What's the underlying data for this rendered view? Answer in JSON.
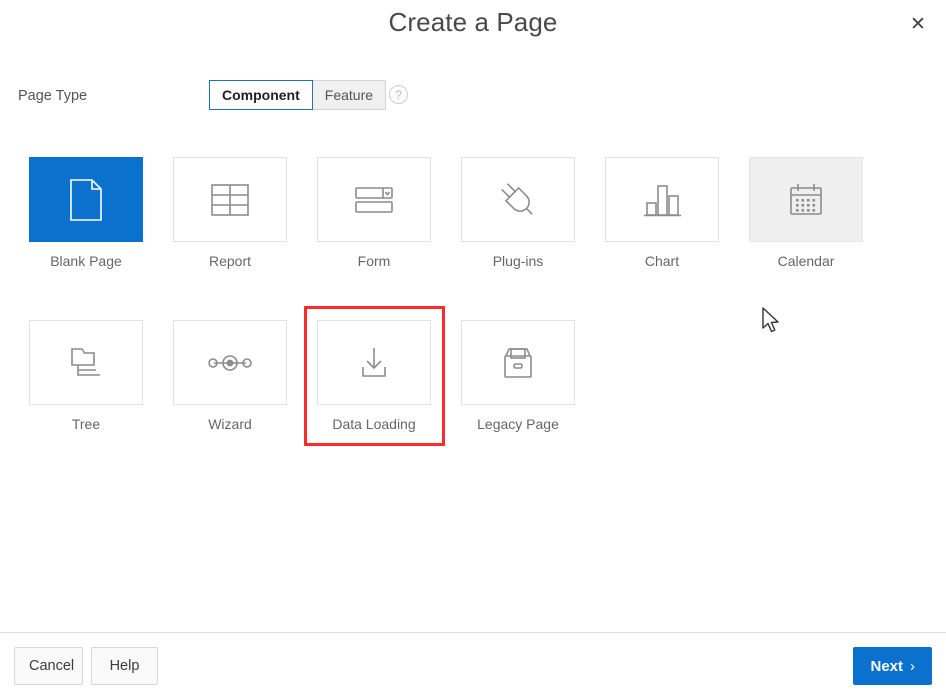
{
  "dialog": {
    "title": "Create a Page",
    "close_icon": "close-icon"
  },
  "page_type": {
    "label": "Page Type",
    "options": [
      {
        "label": "Component",
        "selected": true
      },
      {
        "label": "Feature",
        "selected": false
      }
    ],
    "help_icon_label": "?"
  },
  "colors": {
    "accent_blue": "#0a72ce",
    "toggle_border_blue": "#1b75bb",
    "annotation_red": "#fb2c2c",
    "card_border": "#e2e2e2",
    "card_hover_bg": "#efefef",
    "label_gray": "#666666"
  },
  "cards": {
    "rows": [
      [
        {
          "label": "Blank Page",
          "icon": "document-icon",
          "state": "selected"
        },
        {
          "label": "Report",
          "icon": "table-grid-icon",
          "state": "normal"
        },
        {
          "label": "Form",
          "icon": "form-fields-icon",
          "state": "normal"
        },
        {
          "label": "Plug-ins",
          "icon": "plug-icon",
          "state": "normal"
        },
        {
          "label": "Chart",
          "icon": "bar-chart-icon",
          "state": "normal"
        },
        {
          "label": "Calendar",
          "icon": "calendar-icon",
          "state": "hovered"
        }
      ],
      [
        {
          "label": "Tree",
          "icon": "folder-tree-icon",
          "state": "normal"
        },
        {
          "label": "Wizard",
          "icon": "wizard-nodes-icon",
          "state": "normal"
        },
        {
          "label": "Data Loading",
          "icon": "download-tray-icon",
          "state": "annotated"
        },
        {
          "label": "Legacy Page",
          "icon": "file-box-icon",
          "state": "normal"
        }
      ]
    ]
  },
  "footer": {
    "cancel_label": "Cancel",
    "help_label": "Help",
    "next_label": "Next",
    "next_chevron": "›"
  }
}
